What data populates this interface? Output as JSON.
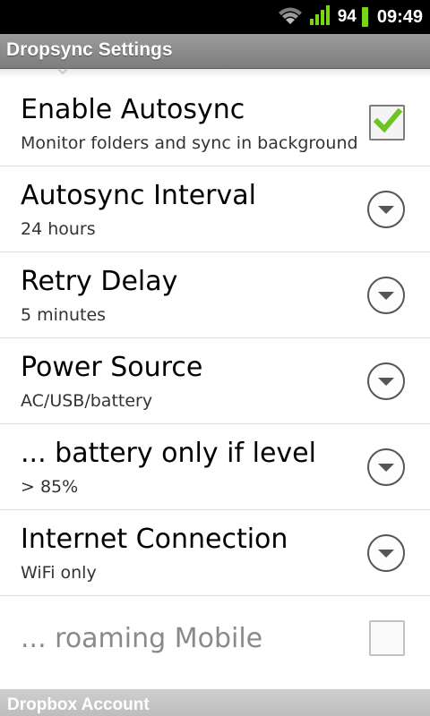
{
  "status_bar": {
    "battery_percent": "94",
    "time": "09:49",
    "icons": [
      "wifi-icon",
      "signal-icon",
      "battery-icon"
    ]
  },
  "title_bar": {
    "title": "Dropsync Settings"
  },
  "settings": [
    {
      "title": "Enable Autosync",
      "summary": "Monitor folders and sync in background",
      "control": "checkbox",
      "checked": true,
      "enabled": true
    },
    {
      "title": "Autosync Interval",
      "summary": "24 hours",
      "control": "dropdown",
      "enabled": true
    },
    {
      "title": "Retry Delay",
      "summary": "5 minutes",
      "control": "dropdown",
      "enabled": true
    },
    {
      "title": "Power Source",
      "summary": "AC/USB/battery",
      "control": "dropdown",
      "enabled": true
    },
    {
      "title": "... battery only if level",
      "summary": "> 85%",
      "control": "dropdown",
      "enabled": true
    },
    {
      "title": "Internet Connection",
      "summary": "WiFi only",
      "control": "dropdown",
      "enabled": true
    },
    {
      "title": "... roaming Mobile",
      "summary": "",
      "control": "checkbox",
      "checked": false,
      "enabled": false
    }
  ],
  "category": {
    "label": "Dropbox Account"
  },
  "colors": {
    "check_green": "#6cc520",
    "battery_green": "#7ad615",
    "signal_green": "#7ad615"
  }
}
